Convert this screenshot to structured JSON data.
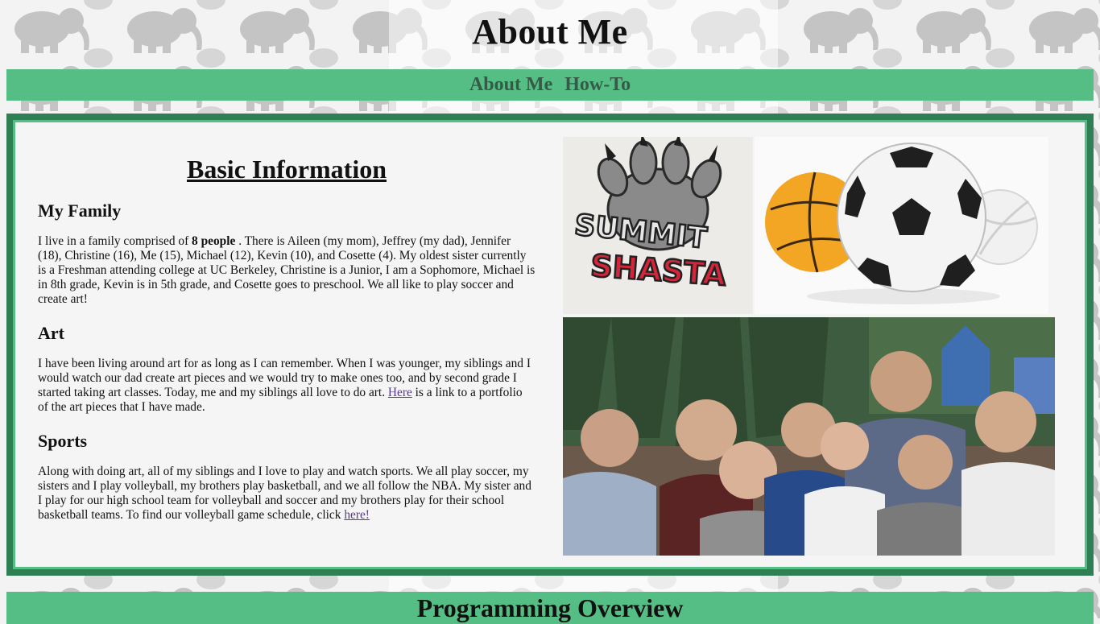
{
  "page": {
    "title": "About Me",
    "nav": [
      {
        "label": "About Me"
      },
      {
        "label": "How-To"
      }
    ]
  },
  "info": {
    "heading": "Basic Information",
    "family": {
      "title": "My Family",
      "text_before": "I live in a family comprised of ",
      "bold": "8 people",
      "text_after": " . There is Aileen (my mom), Jeffrey (my dad), Jennifer (18), Christine (16), Me (15), Michael (12), Kevin (10), and Cosette (4). My oldest sister currently is a Freshman attending college at UC Berkeley, Christine is a Junior, I am a Sophomore, Michael is in 8th grade, Kevin is in 5th grade, and Cosette goes to preschool. We all like to play soccer and create art!"
    },
    "art": {
      "title": "Art",
      "text_before": "I have been living around art for as long as I can remember. When I was younger, my siblings and I would watch our dad create art pieces and we would try to make ones too, and by second grade I started taking art classes. Today, me and my siblings all love to do art. ",
      "link": "Here",
      "text_after": " is a link to a portfolio of the art pieces that I have made."
    },
    "sports": {
      "title": "Sports",
      "text_before": "Along with doing art, all of my siblings and I love to play and watch sports. We all play soccer, my sisters and I play volleyball, my brothers play basketball, and we all follow the NBA. My sister and I play for our high school team for volleyball and soccer and my brothers play for their school basketball teams. To find our volleyball game schedule, click ",
      "link": "here!"
    }
  },
  "images": {
    "logo_text_top": "SUMMIT",
    "logo_text_bottom": "SHASTA"
  },
  "bottom": {
    "title": "Programming Overview"
  },
  "colors": {
    "accent_green": "#55be85",
    "dark_green": "#2f7f55",
    "nav_text": "#355a48",
    "link": "#5b3a8a"
  }
}
